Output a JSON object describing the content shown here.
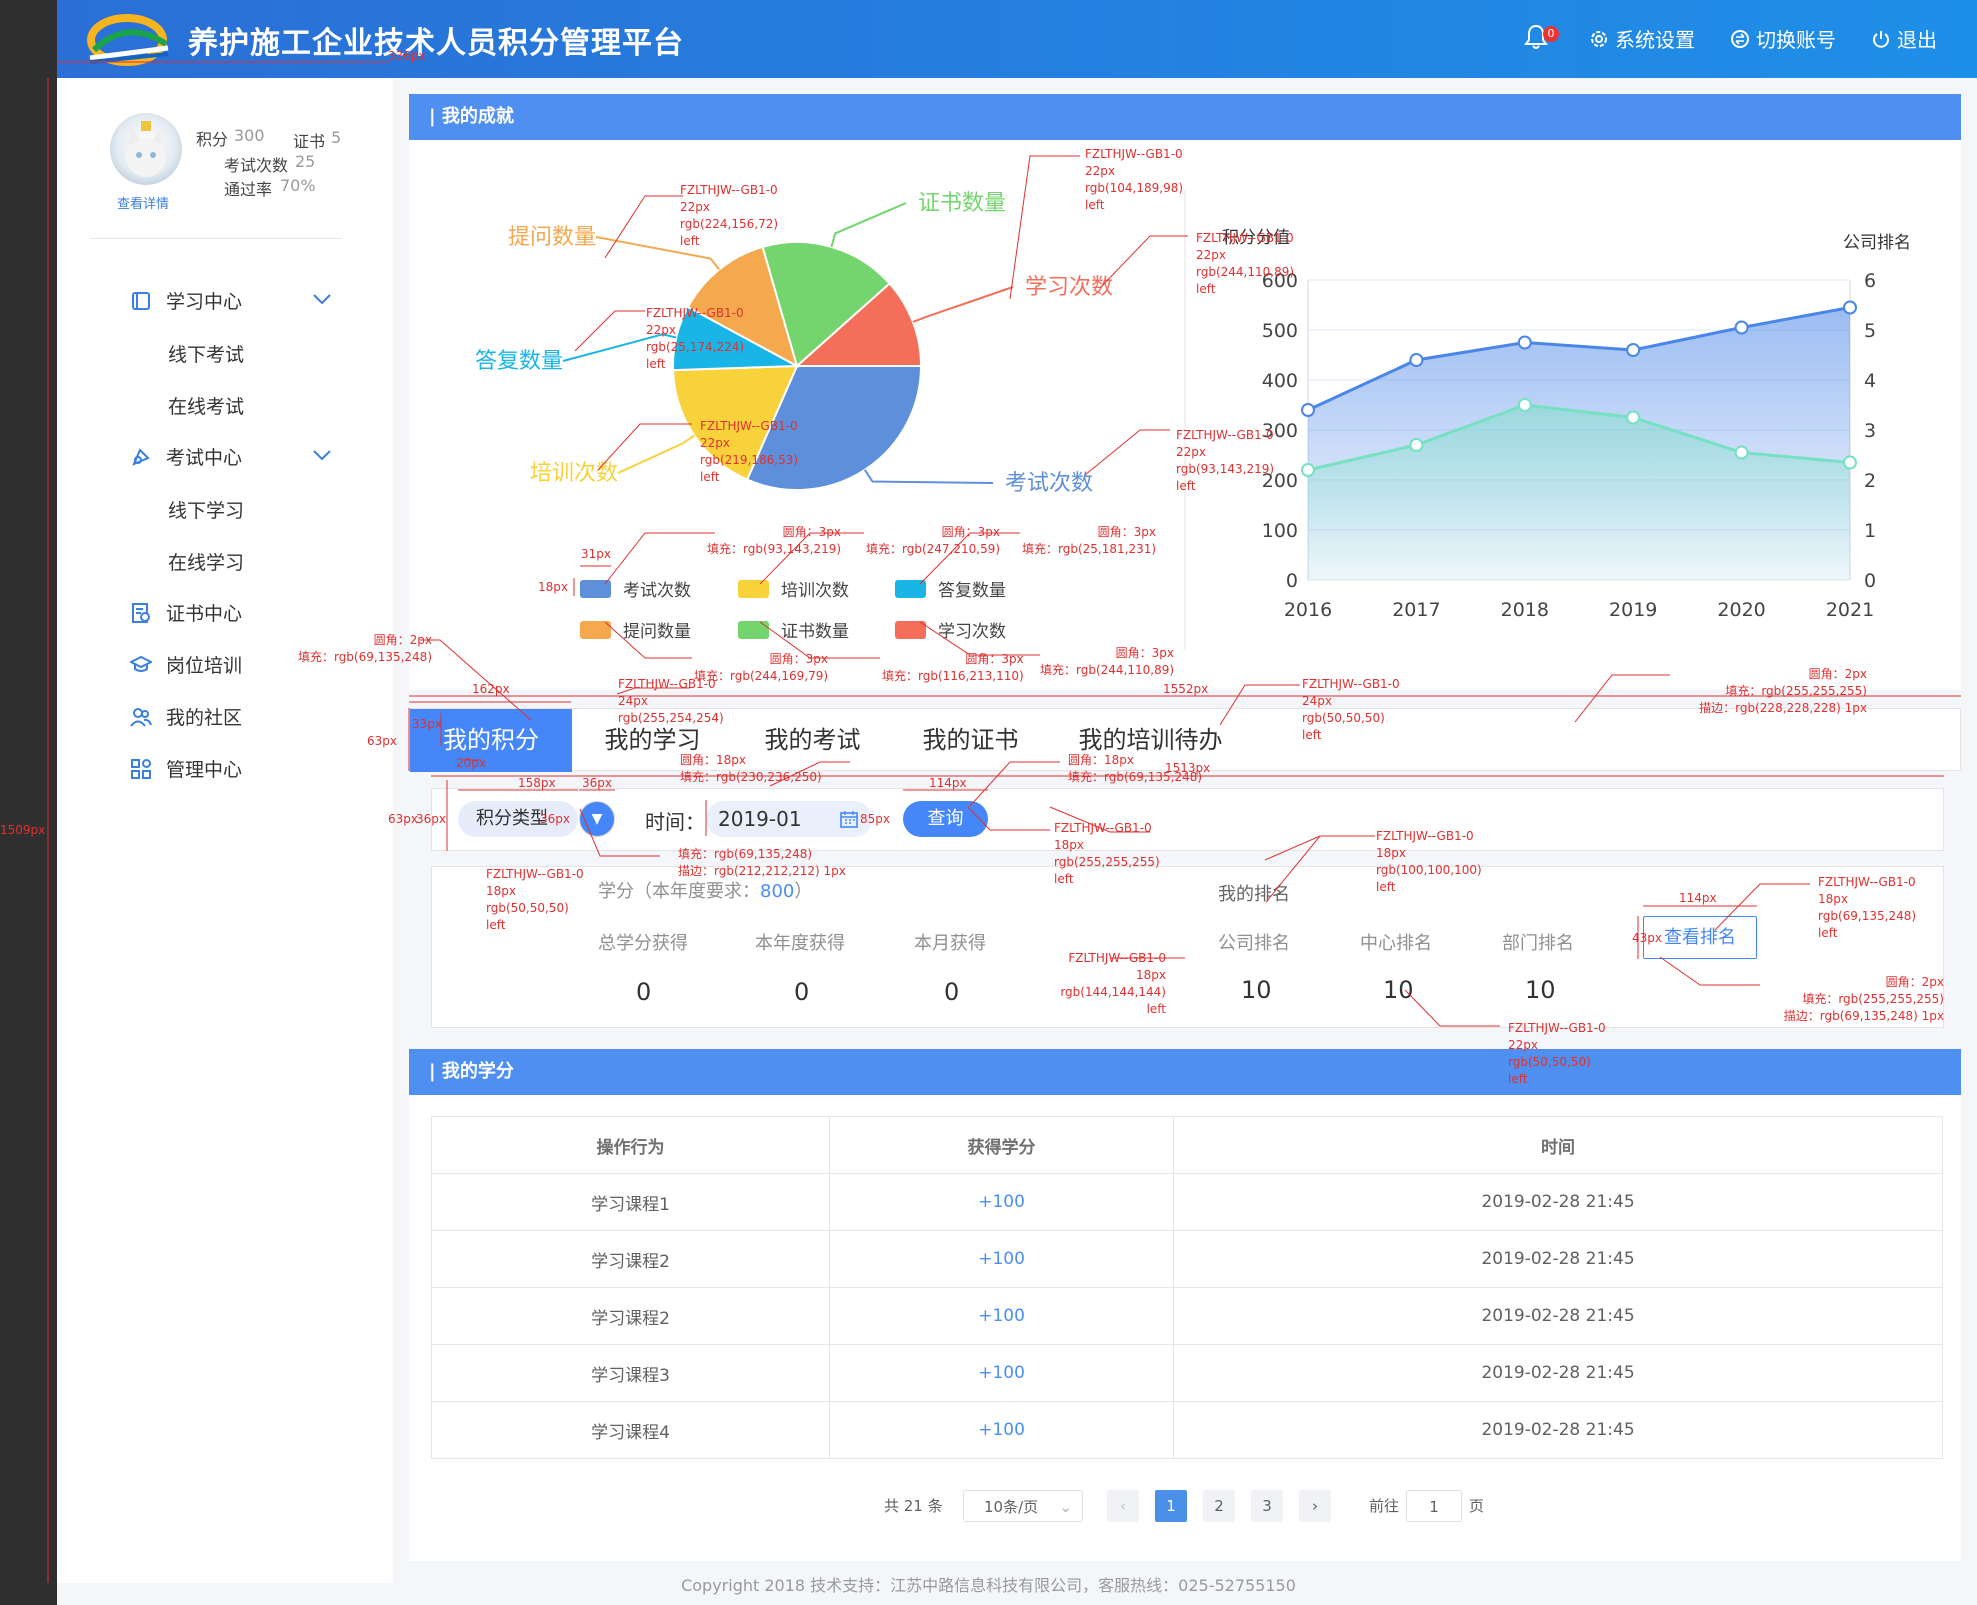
{
  "header": {
    "title": "养护施工企业技术人员积分管理平台",
    "notif_count": "0",
    "settings": "系统设置",
    "switch_account": "切换账号",
    "logout": "退出"
  },
  "profile": {
    "points_label": "积分",
    "points": "300",
    "cert_label": "证书",
    "certs": "5",
    "exams_label": "考试次数",
    "exams": "25",
    "pass_label": "通过率",
    "pass_rate": "70%",
    "detail_link": "查看详情"
  },
  "nav": {
    "learning": "学习中心",
    "offline_exam": "线下考试",
    "online_exam": "在线考试",
    "exam": "考试中心",
    "offline_study": "线下学习",
    "online_study": "在线学习",
    "cert": "证书中心",
    "training": "岗位培训",
    "community": "我的社区",
    "manage": "管理中心"
  },
  "achievement": {
    "title": "我的成就"
  },
  "chart_data": [
    {
      "type": "pie",
      "slices": [
        {
          "label": "考试次数",
          "value": 30,
          "color": "#5d8fdb"
        },
        {
          "label": "培训次数",
          "value": 17,
          "color": "#f7d23b"
        },
        {
          "label": "答复数量",
          "value": 8,
          "color": "#19b5e7"
        },
        {
          "label": "提问数量",
          "value": 12,
          "color": "#f4a94f"
        },
        {
          "label": "证书数量",
          "value": 17,
          "color": "#74d56e"
        },
        {
          "label": "学习次数",
          "value": 11,
          "color": "#f46e5a"
        }
      ]
    },
    {
      "type": "area",
      "title": "积分分值",
      "right_axis_title": "公司排名",
      "x": [
        "2016",
        "2017",
        "2018",
        "2019",
        "2020",
        "2021"
      ],
      "ylim": [
        0,
        600
      ],
      "yticks": [
        "0",
        "100",
        "200",
        "300",
        "400",
        "500",
        "600"
      ],
      "y2lim": [
        0,
        6
      ],
      "y2ticks": [
        "0",
        "1",
        "2",
        "3",
        "4",
        "5",
        "6"
      ],
      "series": [
        {
          "values": [
            340,
            440,
            475,
            460,
            505,
            545
          ],
          "color": "#4a86e8"
        },
        {
          "values": [
            2.2,
            2.7,
            3.5,
            3.25,
            2.55,
            2.35
          ],
          "axis": "right",
          "color": "#76e0c2"
        }
      ]
    }
  ],
  "legend_labels": [
    "考试次数",
    "培训次数",
    "答复数量",
    "提问数量",
    "证书数量",
    "学习次数"
  ],
  "tabs": [
    "我的积分",
    "我的学习",
    "我的考试",
    "我的证书",
    "我的培训待办"
  ],
  "filter": {
    "type": "积分类型",
    "time_label": "时间：",
    "date": "2019-01",
    "query": "查询"
  },
  "score": {
    "heading": "学分（本年度要求：",
    "requirement": "800",
    "heading_end": "）",
    "total_label": "总学分获得",
    "year_label": "本年度获得",
    "month_label": "本月获得",
    "total": "0",
    "year": "0",
    "month": "0",
    "rank_heading": "我的排名",
    "company_label": "公司排名",
    "center_label": "中心排名",
    "dept_label": "部门排名",
    "company": "10",
    "center": "10",
    "dept": "10",
    "rank_btn": "查看排名"
  },
  "credits": {
    "title": "我的学分",
    "columns": [
      "操作行为",
      "获得学分",
      "时间"
    ],
    "rows": [
      [
        "学习课程1",
        "+100",
        "2019-02-28 21:45"
      ],
      [
        "学习课程2",
        "+100",
        "2019-02-28 21:45"
      ],
      [
        "学习课程2",
        "+100",
        "2019-02-28 21:45"
      ],
      [
        "学习课程3",
        "+100",
        "2019-02-28 21:45"
      ],
      [
        "学习课程4",
        "+100",
        "2019-02-28 21:45"
      ]
    ]
  },
  "pagination": {
    "total": "共 21 条",
    "page_size": "10条/页",
    "pages": [
      "1",
      "2",
      "3"
    ],
    "goto": "前往",
    "goto_value": "1",
    "page_unit": "页"
  },
  "footer": "Copyright 2018 技术支持：江苏中路信息科技有限公司，客服热线：025-52755150",
  "annotations": [
    "158px",
    "36px",
    "20px",
    "31px",
    "18px",
    "162px",
    "33px",
    "63px",
    "63px",
    "36px",
    "36px",
    "85px",
    "114px",
    "43px",
    "1552px",
    "1513px",
    "1509px",
    "336px",
    "FZLTHJW--GB1-0",
    "22px",
    "rgb(224,156,72)",
    "left",
    "FZLTHJW--GB1-0",
    "22px",
    "rgb(104,189,98)",
    "left",
    "FZLTHJW--GB1-0",
    "22px",
    "rgb(244,110,89)",
    "left",
    "FZLTHJW--GB1-0",
    "22px",
    "rgb(25,174,224)",
    "left",
    "FZLTHJW--GB1-0",
    "22px",
    "rgb(219,186,53)",
    "left",
    "FZLTHJW--GB1-0",
    "22px",
    "rgb(93,143,219)",
    "left",
    "圆角：3px",
    "填充：rgb(93,143,219)",
    "圆角：3px",
    "填充：rgb(247,210,59)",
    "圆角：3px",
    "填充：rgb(25,181,231)",
    "圆角：3px",
    "填充：rgb(244,169,79)",
    "圆角：3px",
    "填充：rgb(116,213,110)",
    "圆角：3px",
    "填充：rgb(244,110,89)",
    "圆角：2px",
    "填充：rgb(69,135,248)",
    "FZLTHJW--GB1-0",
    "24px",
    "rgb(255,254,254)",
    "FZLTHJW--GB1-0",
    "24px",
    "rgb(50,50,50)",
    "left",
    "圆角：2px",
    "填充：rgb(255,255,255)",
    "描边：rgb(228,228,228) 1px",
    "圆角：18px",
    "填充：rgb(230,236,250)",
    "圆角：18px",
    "填充：rgb(69,135,248)",
    "填充：rgb(69,135,248)",
    "描边：rgb(212,212,212) 1px",
    "FZLTHJW--GB1-0",
    "18px",
    "rgb(50,50,50)",
    "left",
    "FZLTHJW--GB1-0",
    "18px",
    "rgb(255,255,255)",
    "left",
    "FZLTHJW--GB1-0",
    "18px",
    "rgb(100,100,100)",
    "left",
    "FZLTHJW--GB1-0",
    "18px",
    "rgb(144,144,144)",
    "left",
    "FZLTHJW--GB1-0",
    "18px",
    "rgb(69,135,248)",
    "left",
    "圆角：2px",
    "填充：rgb(255,255,255)",
    "描边：rgb(69,135,248) 1px",
    "FZLTHJW--GB1-0",
    "22px",
    "rgb(50,50,50)",
    "left"
  ]
}
